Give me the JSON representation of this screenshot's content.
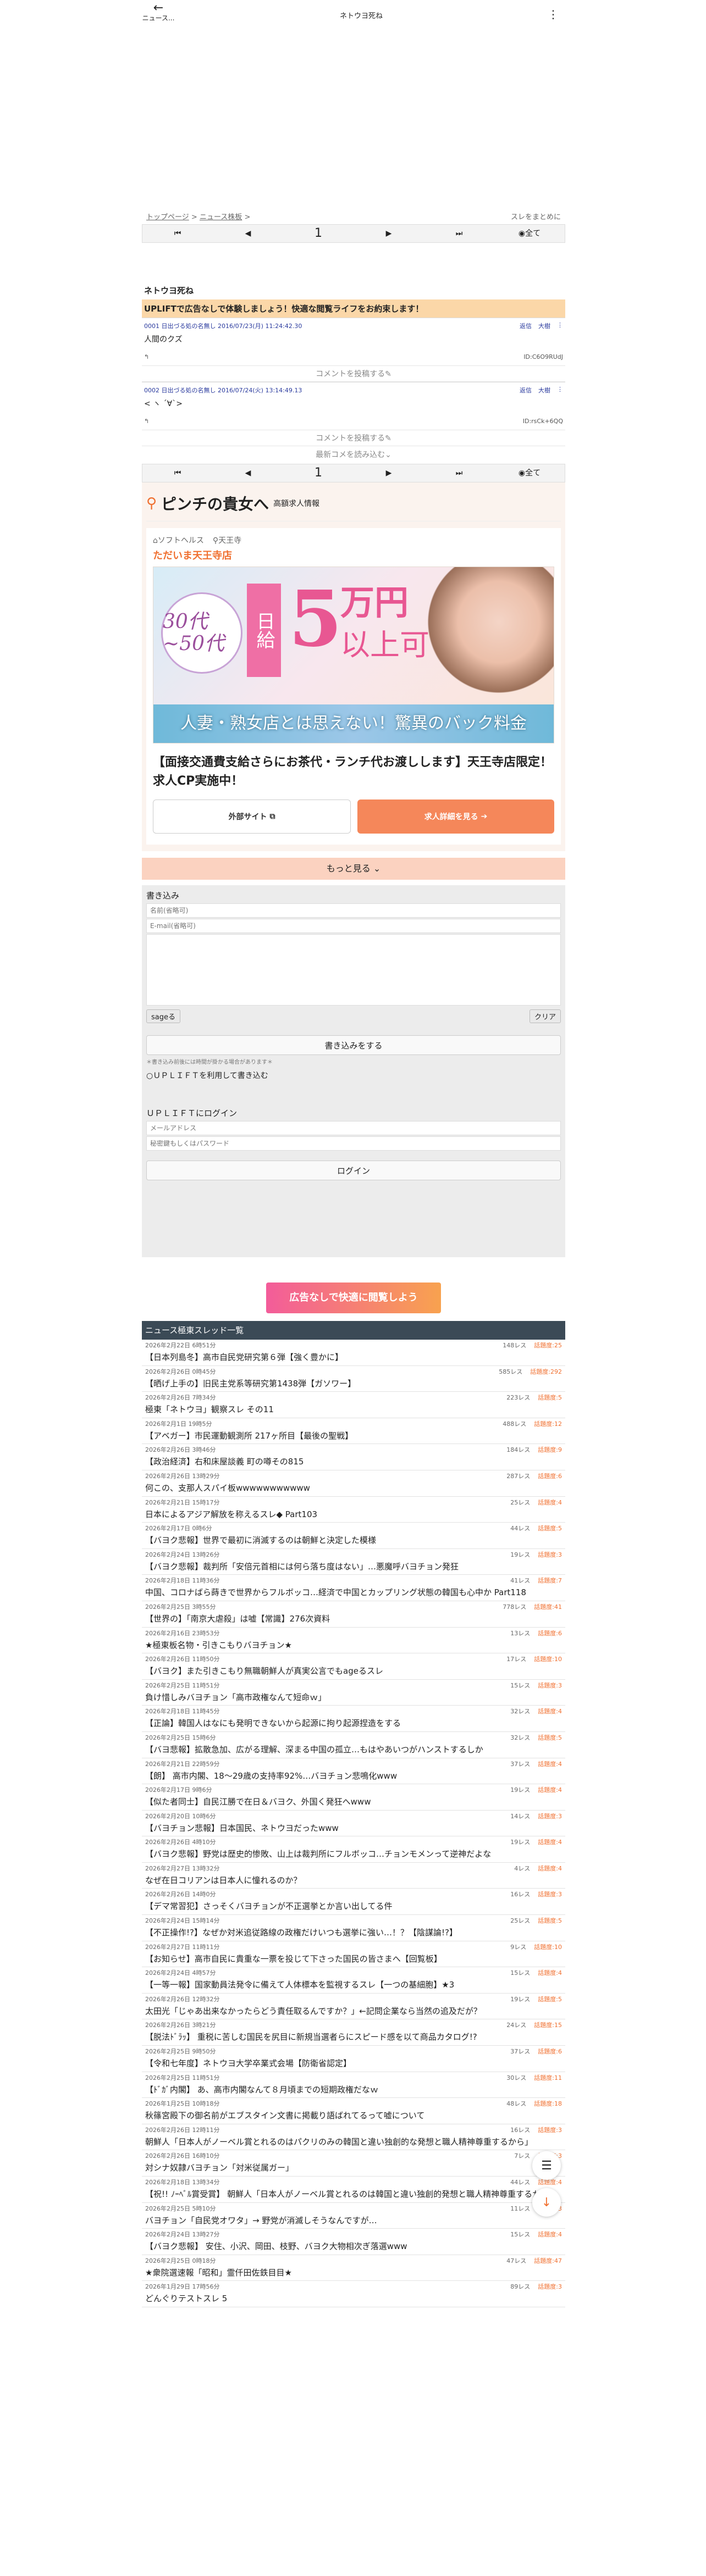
{
  "header": {
    "back_label": "ニュース...",
    "title": "ネトウヨ死ね",
    "menu_icon": "kebab-icon"
  },
  "breadcrumb": {
    "top": "トップページ",
    "news": "ニュース株板",
    "sep": ">",
    "right": "スレをまとめに"
  },
  "pager": {
    "first": "⏮",
    "prev": "◀",
    "page": "1",
    "next": "▶",
    "last": "⏭",
    "all": "全て"
  },
  "thread": {
    "title": "ネトウヨ死ね",
    "banner": "UPLIFTで広告なしで体験しましょう！快適な閲覧ライフをお約束します！"
  },
  "posts": [
    {
      "meta": "0001 日出づる処の名無し 2016/07/23(月) 11:24:42.30",
      "opt1": "返信",
      "opt2": "大樹",
      "body": "人間のクズ",
      "id": "ID:C6O9RUdJ"
    },
    {
      "meta": "0002 日出づる処の名無し 2016/07/24(火) 13:14:49.13",
      "opt1": "返信",
      "opt2": "大樹",
      "body": "< ヽ ´∀`>",
      "id": "ID:rsCk+6QQ"
    }
  ],
  "comment_label": "コメントを投稿する",
  "read_latest": "最新コメを読み込む",
  "ad": {
    "title": "ピンチの貴女へ",
    "subtitle": "高額求人情報",
    "tag1": "ソフトヘルス",
    "tag2": "天王寺",
    "shop": "ただいま天王寺店",
    "img_age": "30代~50代",
    "img_daily": "日給",
    "img_amount": "5",
    "img_man": "万円",
    "img_ok": "以上可",
    "img_strip": "人妻・熟女店とは思えない！驚異のバック料金",
    "headline": "【面接交通費支給さらにお茶代・ランチ代お渡しします】天王寺店限定！求人CP実施中！",
    "ext_btn": "外部サイト",
    "detail_btn": "求人詳細を見る"
  },
  "more": "もっと見る",
  "form": {
    "label": "書き込み",
    "name_ph": "名前(省略可)",
    "mail_ph": "E-mail(省略可)",
    "sage": "sageる",
    "clear": "クリア",
    "submit": "書き込みをする",
    "note": "＊書き込み前後には時間が掛かる場合があります＊",
    "uplift_chk": "ＵＰＬＩＦＴを利用して書き込む",
    "login_title": "ＵＰＬＩＦＴにログイン",
    "mail_login_ph": "メールアドレス",
    "pass_ph": "秘密鍵もしくはパスワード",
    "login": "ログイン"
  },
  "pr_banner": "広告なしで快適に閲覧しよう",
  "list": {
    "header": "ニュース極東スレッド一覧",
    "items": [
      {
        "d": "2026年2月22日 6時51分",
        "r": "148レス",
        "h": "話題度:25",
        "t": "【日本列島冬】高市自民党研究第６弾【強く豊かに】"
      },
      {
        "d": "2026年2月26日 0時45分",
        "r": "585レス",
        "h": "話題度:292",
        "t": "【晒げ上手の】旧民主党系等研究第1438弾【ガソワー】"
      },
      {
        "d": "2026年2月26日 7時34分",
        "r": "223レス",
        "h": "話題度:5",
        "t": "極東「ネトウヨ」観察スレ その11"
      },
      {
        "d": "2026年2月1日 19時5分",
        "r": "488レス",
        "h": "話題度:12",
        "t": "【アベガー】市民運動観測所 217ヶ所目【最後の聖戦】"
      },
      {
        "d": "2026年2月26日 3時46分",
        "r": "184レス",
        "h": "話題度:9",
        "t": "【政治経済】右和床屋談義 町の噂その815"
      },
      {
        "d": "2026年2月26日 13時29分",
        "r": "287レス",
        "h": "話題度:6",
        "t": "何この、支那人スパイ板wwwwwwwwwww"
      },
      {
        "d": "2026年2月21日 15時17分",
        "r": "25レス",
        "h": "話題度:4",
        "t": "日本によるアジア解放を称えるスレ◆ Part103"
      },
      {
        "d": "2026年2月17日 0時6分",
        "r": "44レス",
        "h": "話題度:5",
        "t": "【バヨク悲報】世界で最初に消滅するのは朝鮮と決定した模様"
      },
      {
        "d": "2026年2月24日 13時26分",
        "r": "19レス",
        "h": "話題度:3",
        "t": "【バヨク悲報】裁判所「安倍元首相には何ら落ち度はない」…悪魔呼バヨチョン発狂"
      },
      {
        "d": "2026年2月18日 11時36分",
        "r": "41レス",
        "h": "話題度:7",
        "t": "中国、コロナばら蒔きで世界からフルボッコ…経済で中国とカップリング状態の韓国も心中か Part118"
      },
      {
        "d": "2026年2月25日 3時55分",
        "r": "778レス",
        "h": "話題度:41",
        "t": "【世界の】「南京大虐殺」は嘘【常識】276次資料"
      },
      {
        "d": "2026年2月16日 23時53分",
        "r": "13レス",
        "h": "話題度:6",
        "t": "★極東板名物・引きこもりバヨチョン★"
      },
      {
        "d": "2026年2月26日 11時50分",
        "r": "17レス",
        "h": "話題度:10",
        "t": "【バヨク】また引きこもり無職朝鮮人が真実公言でもageるスレ"
      },
      {
        "d": "2026年2月25日 11時51分",
        "r": "15レス",
        "h": "話題度:3",
        "t": "負け惜しみバヨチョン「高市政権なんて短命ｗ」"
      },
      {
        "d": "2026年2月18日 11時45分",
        "r": "32レス",
        "h": "話題度:4",
        "t": "【正論】韓国人はなにも発明できないから起源に拘り起源捏造をする"
      },
      {
        "d": "2026年2月25日 15時6分",
        "r": "32レス",
        "h": "話題度:5",
        "t": "【バヨ悲報】拡散急加、広がる理解、深まる中国の孤立…もはやあいつがハンストするしか"
      },
      {
        "d": "2026年2月21日 22時59分",
        "r": "37レス",
        "h": "話題度:4",
        "t": "【朗】 高市内閣、18～29歳の支持率92%…バヨチョン悲鳴化www"
      },
      {
        "d": "2026年2月17日 9時6分",
        "r": "19レス",
        "h": "話題度:4",
        "t": "【似た者同士】自民江勝で在日＆バヨク、外国く発狂へwww"
      },
      {
        "d": "2026年2月20日 10時6分",
        "r": "14レス",
        "h": "話題度:3",
        "t": "【バヨチョン悲報】日本国民、ネトウヨだったwww"
      },
      {
        "d": "2026年2月26日 4時10分",
        "r": "19レス",
        "h": "話題度:4",
        "t": "【バヨク悲報】野党は歴史的惨敗、山上は裁判所にフルボッコ…チョンモメンって逆神だよな"
      },
      {
        "d": "2026年2月27日 13時32分",
        "r": "4レス",
        "h": "話題度:4",
        "t": "なぜ在日コリアンは日本人に憧れるのか？"
      },
      {
        "d": "2026年2月26日 14時0分",
        "r": "16レス",
        "h": "話題度:3",
        "t": "【デマ常習犯】さっそくバヨチョンが不正選挙とか言い出してる件"
      },
      {
        "d": "2026年2月24日 15時14分",
        "r": "25レス",
        "h": "話題度:5",
        "t": "【不正操作!?】なぜか対米追従路線の政権だけいつも選挙に強い…！？【陰謀論!?】"
      },
      {
        "d": "2026年2月27日 11時11分",
        "r": "9レス",
        "h": "話題度:10",
        "t": "【お知らせ】高市自民に貴重な一票を投じて下さった国民の皆さまへ【回覧板】"
      },
      {
        "d": "2026年2月24日 4時57分",
        "r": "15レス",
        "h": "話題度:4",
        "t": "【一等一報】国家動員法発令に備えて人体標本を監視するスレ【一つの基細胞】★3"
      },
      {
        "d": "2026年2月26日 12時32分",
        "r": "19レス",
        "h": "話題度:5",
        "t": "太田光「じゃあ出来なかったらどう責任取るんですか？」←記問企業なら当然の追及だが？"
      },
      {
        "d": "2026年2月26日 3時21分",
        "r": "24レス",
        "h": "話題度:15",
        "t": "【脱法ﾄﾞﾗｯ】 重税に苦しむ国民を尻目に新規当選者らにスピード感を以て商品カタログ!?"
      },
      {
        "d": "2026年2月25日 9時50分",
        "r": "37レス",
        "h": "話題度:6",
        "t": "【令和七年度】ネトウヨ大学卒業式会場【防衛省認定】"
      },
      {
        "d": "2026年2月25日 11時51分",
        "r": "30レス",
        "h": "話題度:11",
        "t": "【ﾄﾞｶﾞ内閣】 あ、高市内閣なんて８月頃までの短期政権だなｗ"
      },
      {
        "d": "2026年1月25日 10時18分",
        "r": "48レス",
        "h": "話題度:18",
        "t": "秋篠宮殿下の御名前がエブスタイン文書に掲載り語ばれてるって嘘について"
      },
      {
        "d": "2026年2月26日 12時11分",
        "r": "16レス",
        "h": "話題度:3",
        "t": "朝鮮人「日本人がノーベル賞とれるのはパクリのみの韓国と違い独創的な発想と職人精神尊重するから」"
      },
      {
        "d": "2026年2月26日 16時10分",
        "r": "7レス",
        "h": "話題度:3",
        "t": "対シナ奴隷バヨチョン「対米従属ガー」"
      },
      {
        "d": "2026年2月18日 13時34分",
        "r": "44レス",
        "h": "話題度:4",
        "t": "【祝!! ﾉｰﾍﾞﾙ賞受賞】 朝鮮人「日本人がノーベル賞とれるのは韓国と違い独創的発想と職人精神尊重するから」"
      },
      {
        "d": "2026年2月25日 5時10分",
        "r": "11レス",
        "h": "話題度:3",
        "t": "バヨチョン「自民党オワタ」→ 野党が消滅しそうなんですが…"
      },
      {
        "d": "2026年2月24日 13時27分",
        "r": "15レス",
        "h": "話題度:4",
        "t": "【バヨク悲報】 安住、小沢、岡田、枝野、バヨク大物相次ぎ落選www"
      },
      {
        "d": "2026年2月25日 0時18分",
        "r": "47レス",
        "h": "話題度:47",
        "t": "★衆院選速報「昭和」霊仟田佐鉄目目★"
      },
      {
        "d": "2026年1月29日 17時56分",
        "r": "89レス",
        "h": "話題度:3",
        "t": "どんぐりテストスレ 5"
      }
    ]
  }
}
